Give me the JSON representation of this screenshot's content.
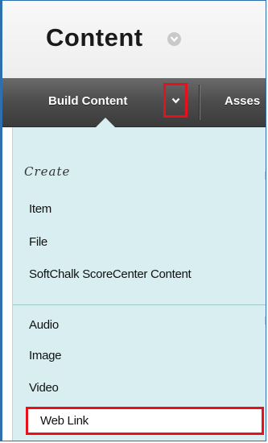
{
  "header": {
    "title": "Content"
  },
  "toolbar": {
    "build_content_label": "Build Content",
    "assessments_label": "Asses"
  },
  "menu": {
    "section_heading": "Create",
    "items_group1": [
      "Item",
      "File",
      "SoftChalk ScoreCenter Content"
    ],
    "items_group2": [
      "Audio",
      "Image",
      "Video"
    ],
    "highlighted_item": "Web Link"
  },
  "colors": {
    "toolbar_bg": "#4e4e4e",
    "menu_bg": "#d8eef0",
    "highlight_border": "#e8101b",
    "window_border": "#2e6fb0"
  }
}
